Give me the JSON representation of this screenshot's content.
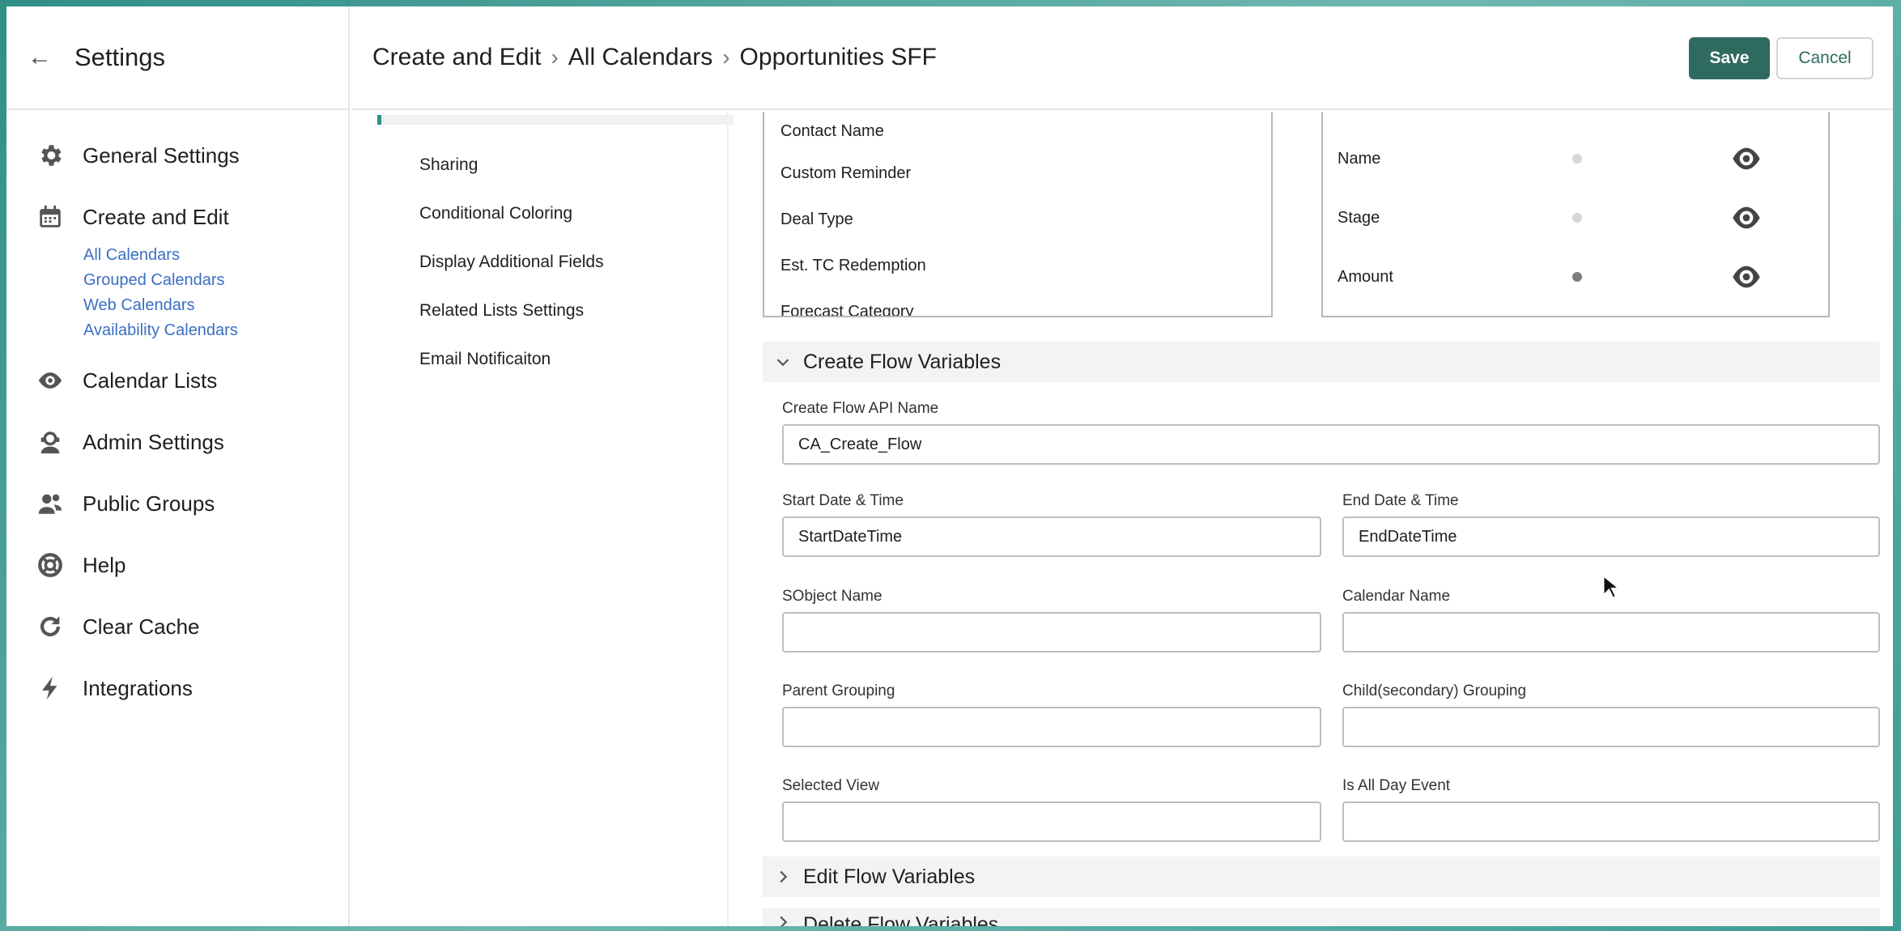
{
  "sidebar": {
    "title": "Settings",
    "items": [
      {
        "label": "General Settings",
        "icon": "gear-icon"
      },
      {
        "label": "Create and Edit",
        "icon": "calendar-icon",
        "children": [
          "All Calendars",
          "Grouped Calendars",
          "Web Calendars",
          "Availability Calendars"
        ]
      },
      {
        "label": "Calendar Lists",
        "icon": "eye-icon"
      },
      {
        "label": "Admin Settings",
        "icon": "admin-icon"
      },
      {
        "label": "Public Groups",
        "icon": "users-icon"
      },
      {
        "label": "Help",
        "icon": "lifebuoy-icon"
      },
      {
        "label": "Clear Cache",
        "icon": "refresh-icon"
      },
      {
        "label": "Integrations",
        "icon": "bolt-icon"
      }
    ]
  },
  "header": {
    "breadcrumbs": [
      "Create and Edit",
      "All Calendars",
      "Opportunities SFF"
    ],
    "save_label": "Save",
    "cancel_label": "Cancel"
  },
  "sections": [
    "Sharing",
    "Conditional Coloring",
    "Display Additional Fields",
    "Related Lists Settings",
    "Email Notificaiton"
  ],
  "available_fields": [
    "Contact Name",
    "Custom Reminder",
    "Deal Type",
    "Est. TC Redemption",
    "Forecast Category"
  ],
  "selected_fields": [
    {
      "label": "Name",
      "required": false
    },
    {
      "label": "Stage",
      "required": false
    },
    {
      "label": "Amount",
      "required": true
    }
  ],
  "create_flow": {
    "title": "Create Flow Variables",
    "api_name_label": "Create Flow API Name",
    "api_name_value": "CA_Create_Flow",
    "start_label": "Start Date & Time",
    "start_value": "StartDateTime",
    "end_label": "End Date & Time",
    "end_value": "EndDateTime",
    "sobject_label": "SObject Name",
    "sobject_value": "",
    "calendar_label": "Calendar Name",
    "calendar_value": "",
    "parent_label": "Parent Grouping",
    "parent_value": "",
    "child_label": "Child(secondary) Grouping",
    "child_value": "",
    "view_label": "Selected View",
    "view_value": "",
    "allday_label": "Is All Day Event",
    "allday_value": ""
  },
  "edit_flow": {
    "title": "Edit Flow Variables"
  },
  "delete_flow": {
    "title": "Delete Flow Variables"
  },
  "colors": {
    "accent": "#2f6a5e",
    "link": "#3b6fc4"
  }
}
